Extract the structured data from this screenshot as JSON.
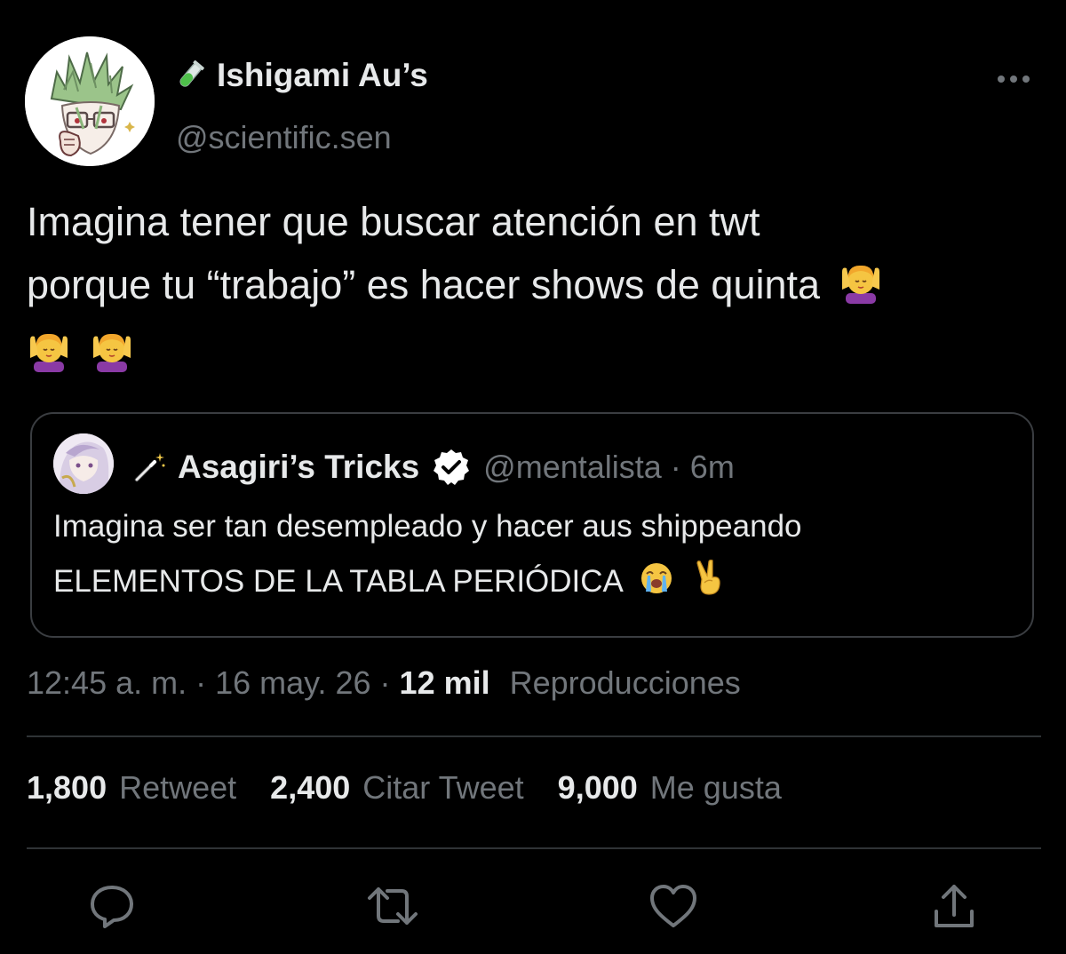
{
  "author": {
    "name": "Ishigami Au’s",
    "handle": "@scientific.sen",
    "name_icon": "test-tube-icon"
  },
  "tweet": {
    "text_line1": "Imagina tener que buscar atención en twt",
    "text_line2": "porque tu “trabajo” es hacer shows de quinta",
    "emoji": "face-massage-emoji"
  },
  "quote": {
    "name": "Asagiri’s Tricks",
    "name_icon": "magic-wand-icon",
    "verified": true,
    "handle": "@mentalista",
    "separator": "·",
    "time": "6m",
    "text_line1": "Imagina ser tan desempleado y hacer aus shippeando",
    "text_line2": "ELEMENTOS DE LA TABLA PERIÓDICA",
    "emojis": [
      "loudly-crying-face-emoji",
      "victory-hand-emoji"
    ]
  },
  "meta": {
    "time": "12:45 a. m.",
    "separator": "·",
    "date": "16 may. 26",
    "views_count": "12 mil",
    "views_label": "Reproducciones"
  },
  "stats": {
    "retweets_count": "1,800",
    "retweets_label": "Retweet",
    "quotes_count": "2,400",
    "quotes_label": "Citar Tweet",
    "likes_count": "9,000",
    "likes_label": "Me gusta"
  },
  "actions": [
    "reply-icon",
    "retweet-icon",
    "like-icon",
    "share-icon"
  ],
  "colors": {
    "background": "#000000",
    "text_primary": "#e7e9ea",
    "text_secondary": "#71767b",
    "border": "#2f3336"
  }
}
